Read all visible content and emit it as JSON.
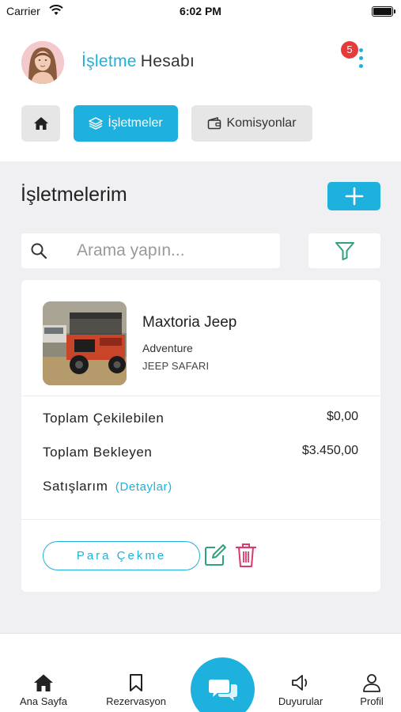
{
  "status_bar": {
    "carrier": "Carrier",
    "time": "6:02 PM"
  },
  "header": {
    "title_accent": "İşletme",
    "title_rest": "Hesabı",
    "notification_count": "5"
  },
  "tabs": [
    {
      "label": "",
      "icon": "home-icon",
      "active": false
    },
    {
      "label": "İşletmeler",
      "icon": "layers-icon",
      "active": true
    },
    {
      "label": "Komisyonlar",
      "icon": "wallet-icon",
      "active": false
    }
  ],
  "section": {
    "title": "İşletmelerim"
  },
  "search": {
    "placeholder": "Arama yapın...",
    "value": ""
  },
  "business": {
    "name": "Maxtoria Jeep",
    "category": "Adventure",
    "subcategory": "JEEP SAFARI",
    "withdrawable_label": "Toplam Çekilebilen",
    "withdrawable_value": "$0,00",
    "pending_label": "Toplam Bekleyen",
    "pending_value": "$3.450,00",
    "sales_label": "Satışlarım",
    "details_link": "(Detaylar)",
    "withdraw_button": "Para Çekme"
  },
  "tabbar": [
    {
      "label": "Ana Sayfa",
      "icon": "home-icon"
    },
    {
      "label": "Rezervasyon",
      "icon": "bookmark-icon"
    },
    {
      "label": "",
      "icon": "chat-icon"
    },
    {
      "label": "Duyurular",
      "icon": "megaphone-icon"
    },
    {
      "label": "Profil",
      "icon": "user-icon"
    }
  ],
  "colors": {
    "accent": "#1fb1dd",
    "danger": "#d93b6a",
    "edit": "#2fa37d",
    "badge": "#e53b3b"
  }
}
